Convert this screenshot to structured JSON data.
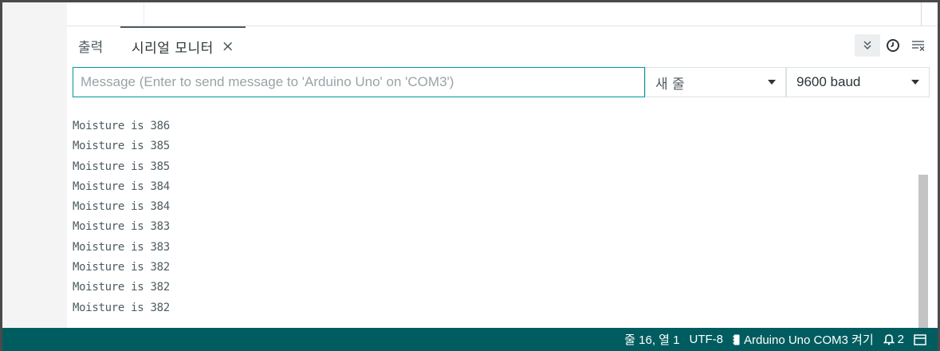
{
  "tabs": {
    "output_label": "출력",
    "serial_label": "시리얼 모니터",
    "close_glyph": "×"
  },
  "toolbar": {
    "autoscroll_icon": "double-chevron-down-icon",
    "timestamp_icon": "clock-icon",
    "clear_icon": "clear-output-icon"
  },
  "input": {
    "placeholder": "Message (Enter to send message to 'Arduino Uno' on 'COM3')",
    "value": ""
  },
  "line_ending": {
    "selected": "새 줄"
  },
  "baud_rate": {
    "selected": "9600 baud"
  },
  "monitor_lines": [
    "Moisture is 386",
    "Moisture is 385",
    "Moisture is 385",
    "Moisture is 384",
    "Moisture is 384",
    "Moisture is 383",
    "Moisture is 383",
    "Moisture is 382",
    "Moisture is 382",
    "Moisture is 382"
  ],
  "statusbar": {
    "cursor_position": "줄 16, 열 1",
    "encoding": "UTF-8",
    "board": "Arduino Uno COM3 켜기",
    "notifications_count": "2"
  },
  "colors": {
    "accent": "#00979c",
    "statusbar_bg": "#005c5f",
    "text": "#4e5b61"
  }
}
